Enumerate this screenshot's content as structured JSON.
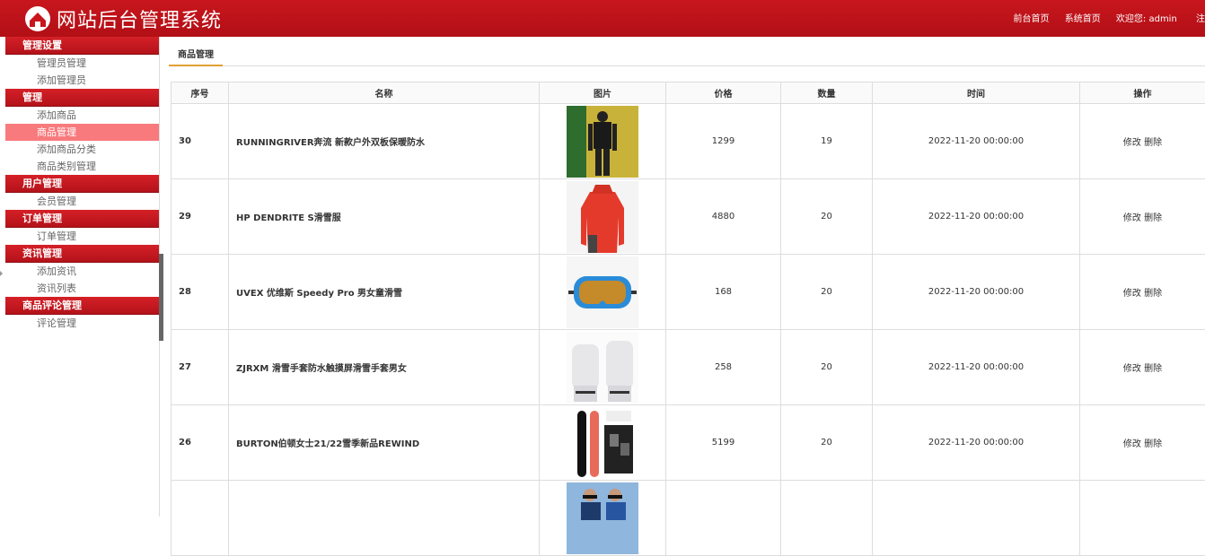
{
  "header": {
    "title": "网站后台管理系统",
    "links": [
      "前台首页",
      "系统首页"
    ],
    "welcome": "欢迎您: admin",
    "logout": "注"
  },
  "sidebar": {
    "groups": [
      {
        "title": "管理设置",
        "items": [
          "管理员管理",
          "添加管理员"
        ]
      },
      {
        "title": "管理",
        "items": [
          "添加商品",
          "商品管理",
          "添加商品分类",
          "商品类别管理"
        ]
      },
      {
        "title": "用户管理",
        "items": [
          "会员管理"
        ]
      },
      {
        "title": "订单管理",
        "items": [
          "订单管理"
        ]
      },
      {
        "title": "资讯管理",
        "items": [
          "添加资讯",
          "资讯列表"
        ]
      },
      {
        "title": "商品评论管理",
        "items": [
          "评论管理"
        ]
      }
    ],
    "active_item": "商品管理"
  },
  "tab": {
    "label": "商品管理"
  },
  "table": {
    "headers": [
      "序号",
      "名称",
      "图片",
      "价格",
      "数量",
      "时间",
      "操作"
    ],
    "rows": [
      {
        "id": "30",
        "name": "RUNNINGRIVER奔流 新款户外双板保暖防水",
        "image": "skier-jacket-photo",
        "price": "1299",
        "qty": "19",
        "time": "2022-11-20 00:00:00",
        "edit": "修改",
        "delete": "删除"
      },
      {
        "id": "29",
        "name": "HP DENDRITE S滑雪服",
        "image": "red-ski-jacket-photo",
        "price": "4880",
        "qty": "20",
        "time": "2022-11-20 00:00:00",
        "edit": "修改",
        "delete": "删除"
      },
      {
        "id": "28",
        "name": "UVEX 优维斯 Speedy Pro 男女童滑雪",
        "image": "ski-goggles-photo",
        "price": "168",
        "qty": "20",
        "time": "2022-11-20 00:00:00",
        "edit": "修改",
        "delete": "删除"
      },
      {
        "id": "27",
        "name": "ZJRXM 滑雪手套防水触摸屏滑雪手套男女",
        "image": "ski-gloves-photo",
        "price": "258",
        "qty": "20",
        "time": "2022-11-20 00:00:00",
        "edit": "修改",
        "delete": "删除"
      },
      {
        "id": "26",
        "name": "BURTON伯顿女士21/22雪季新品REWIND",
        "image": "snowboard-photo",
        "price": "5199",
        "qty": "20",
        "time": "2022-11-20 00:00:00",
        "edit": "修改",
        "delete": "删除"
      },
      {
        "id": "",
        "name": "",
        "image": "skiers-photo",
        "price": "",
        "qty": "",
        "time": "",
        "edit": "",
        "delete": ""
      }
    ]
  },
  "colors": {
    "header_red": "#c8161d",
    "active_item_bg": "#f87a7d",
    "tab_underline": "#e0a030"
  }
}
